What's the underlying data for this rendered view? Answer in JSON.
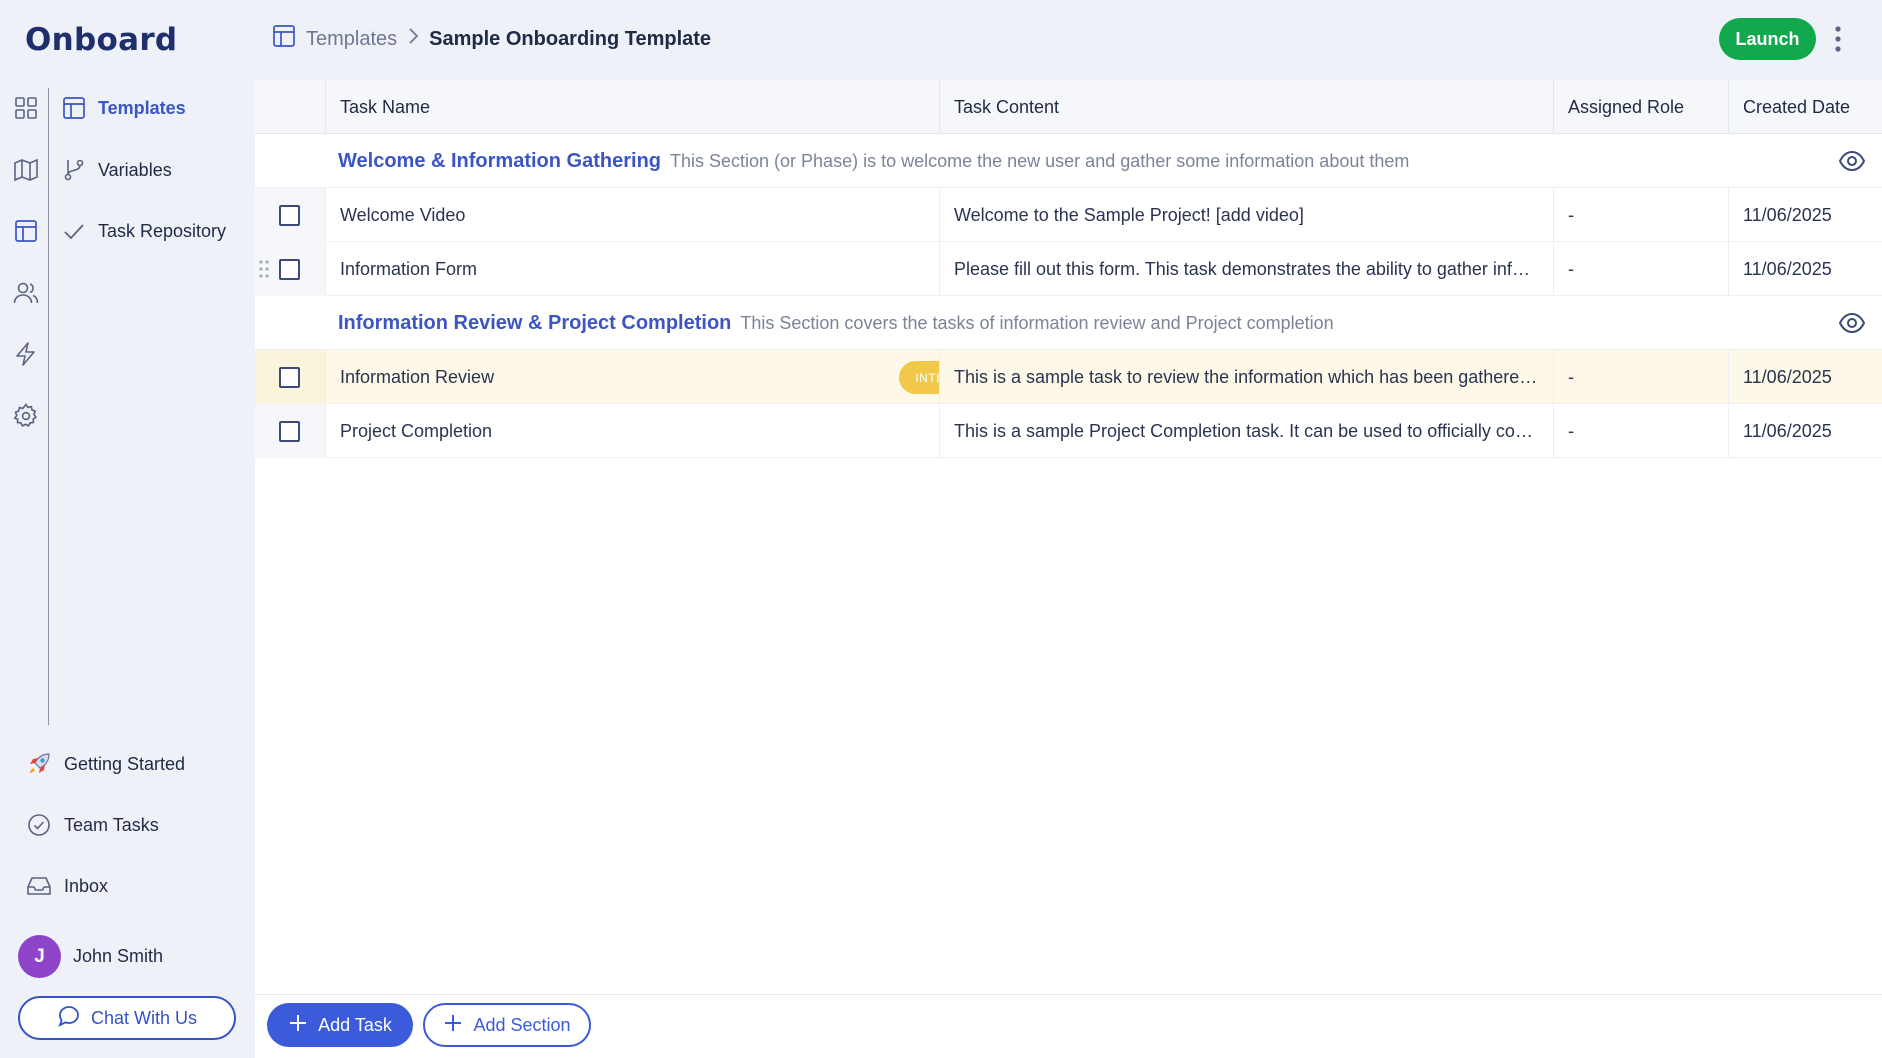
{
  "app": {
    "logo": "Onboard"
  },
  "rail": {
    "icons": [
      "dashboard-icon",
      "map-icon",
      "layout-icon",
      "users-icon",
      "bolt-icon",
      "gear-icon"
    ]
  },
  "subnav": {
    "items": [
      {
        "label": "Templates",
        "icon": "layout-icon",
        "active": true
      },
      {
        "label": "Variables",
        "icon": "branch-icon",
        "active": false
      },
      {
        "label": "Task Repository",
        "icon": "check-icon",
        "active": false
      }
    ]
  },
  "bottom_nav": {
    "getting_started": "Getting Started",
    "team_tasks": "Team Tasks",
    "inbox": "Inbox"
  },
  "user": {
    "initial": "J",
    "name": "John Smith"
  },
  "chat": {
    "label": "Chat With Us"
  },
  "header": {
    "breadcrumb_parent": "Templates",
    "breadcrumb_current": "Sample Onboarding Template",
    "launch_label": "Launch"
  },
  "table": {
    "columns": [
      "Task Name",
      "Task Content",
      "Assigned Role",
      "Created Date"
    ],
    "sections": [
      {
        "name": "Welcome & Information Gathering",
        "description": "This Section (or Phase) is to welcome the new user and gather some information about them",
        "tasks": [
          {
            "name": "Welcome Video",
            "content": "Welcome to the Sample Project! [add video]",
            "role": "-",
            "date": "11/06/2025"
          },
          {
            "name": "Information Form",
            "content": "Please fill out this form. This task demonstrates the ability to gather information from the user",
            "role": "-",
            "date": "11/06/2025"
          }
        ]
      },
      {
        "name": "Information Review & Project Completion",
        "description": "This Section covers the tasks of information review and Project completion",
        "tasks": [
          {
            "name": "Information Review",
            "badge": "INTERNAL",
            "content": "This is a sample task to review the information which has been gathered. It can be assigned internally",
            "role": "-",
            "date": "11/06/2025"
          },
          {
            "name": "Project Completion",
            "content": "This is a sample Project Completion task. It can be used to officially complete the project",
            "role": "-",
            "date": "11/06/2025"
          }
        ]
      }
    ]
  },
  "footer": {
    "add_task": "Add Task",
    "add_section": "Add Section"
  },
  "colors": {
    "accent": "#3b56c4",
    "launch": "#12a84e",
    "badge": "#f2c84b",
    "avatar": "#8e44c9"
  }
}
